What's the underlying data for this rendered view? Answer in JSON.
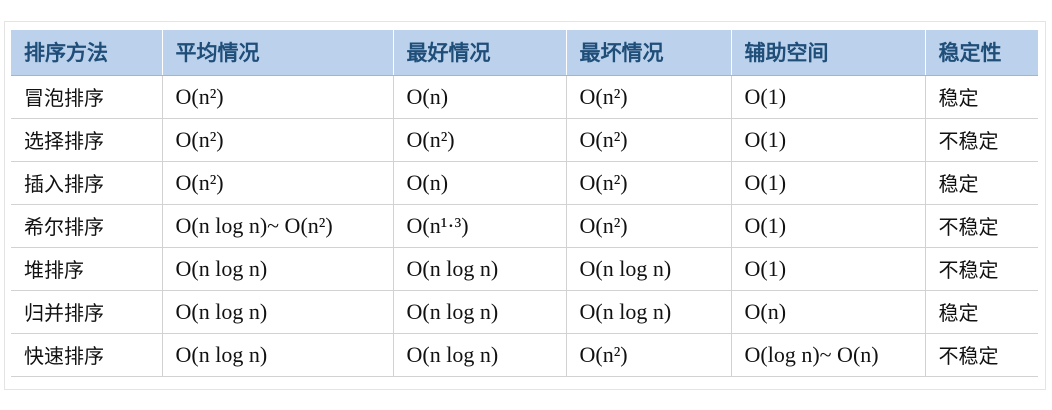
{
  "table": {
    "headers": [
      "排序方法",
      "平均情况",
      "最好情况",
      "最坏情况",
      "辅助空间",
      "稳定性"
    ],
    "rows": [
      [
        "冒泡排序",
        "O(n²)",
        "O(n)",
        "O(n²)",
        "O(1)",
        "稳定"
      ],
      [
        "选择排序",
        "O(n²)",
        "O(n²)",
        "O(n²)",
        "O(1)",
        "不稳定"
      ],
      [
        "插入排序",
        "O(n²)",
        "O(n)",
        "O(n²)",
        "O(1)",
        "稳定"
      ],
      [
        "希尔排序",
        "O(n log n)~ O(n²)",
        "O(n¹·³)",
        "O(n²)",
        "O(1)",
        "不稳定"
      ],
      [
        "堆排序",
        "O(n log n)",
        "O(n log n)",
        "O(n log n)",
        "O(1)",
        "不稳定"
      ],
      [
        "归并排序",
        "O(n log n)",
        "O(n log n)",
        "O(n log n)",
        "O(n)",
        "稳定"
      ],
      [
        "快速排序",
        "O(n log n)",
        "O(n log n)",
        "O(n²)",
        "O(log n)~ O(n)",
        "不稳定"
      ]
    ]
  },
  "colors": {
    "header_bg": "#bcd2ec",
    "header_text": "#1f4e79",
    "grid": "#d2d2d2"
  }
}
